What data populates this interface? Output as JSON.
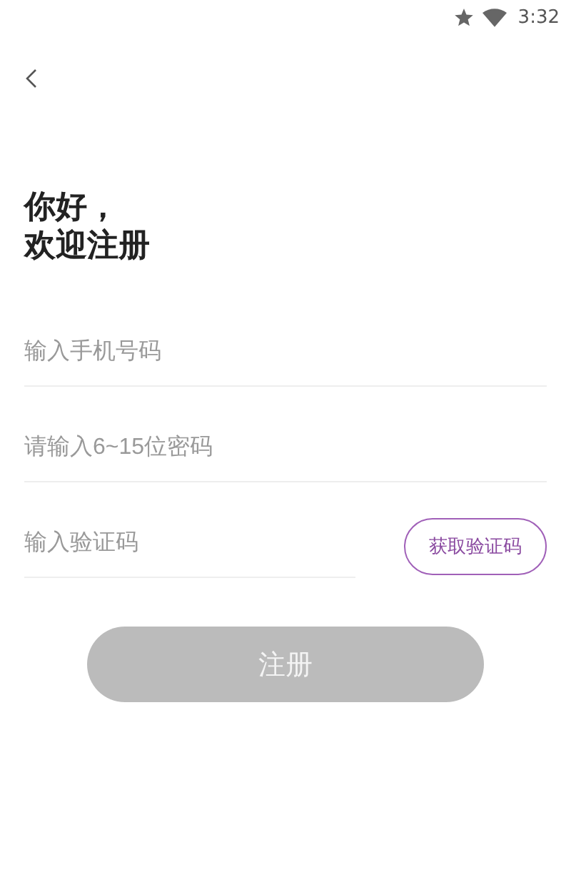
{
  "status_bar": {
    "time": "3:32"
  },
  "title_lines": [
    "你好，",
    "欢迎注册"
  ],
  "fields": [
    {
      "placeholder": "输入手机号码"
    },
    {
      "placeholder": "请输入6~15位密码"
    },
    {
      "placeholder": "输入验证码"
    }
  ],
  "code_button": {
    "label": "获取验证码"
  },
  "register_button": {
    "label": "注册",
    "disabled": true
  }
}
